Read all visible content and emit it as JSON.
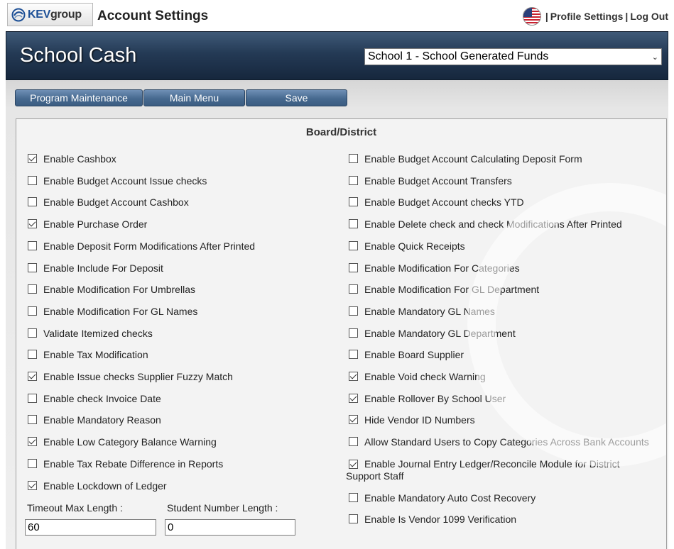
{
  "header": {
    "logo_kev": "KEV",
    "logo_group": "group",
    "app_title": "Account Settings",
    "sep1": "|",
    "profile_settings": "Profile Settings",
    "sep2": "|",
    "log_out": "Log Out"
  },
  "banner": {
    "title": "School Cash",
    "school_selected": "School 1 - School Generated Funds"
  },
  "toolbar": {
    "program_maintenance": "Program Maintenance",
    "main_menu": "Main Menu",
    "save": "Save"
  },
  "panel": {
    "title": "Board/District",
    "left_options": [
      {
        "label": "Enable Cashbox",
        "checked": true
      },
      {
        "label": "Enable Budget Account Issue checks",
        "checked": false
      },
      {
        "label": "Enable Budget Account Cashbox",
        "checked": false
      },
      {
        "label": "Enable Purchase Order",
        "checked": true
      },
      {
        "label": "Enable Deposit Form Modifications After Printed",
        "checked": false
      },
      {
        "label": "Enable Include For Deposit",
        "checked": false
      },
      {
        "label": "Enable Modification For Umbrellas",
        "checked": false
      },
      {
        "label": "Enable Modification For GL Names",
        "checked": false
      },
      {
        "label": "Validate Itemized checks",
        "checked": false
      },
      {
        "label": "Enable Tax Modification",
        "checked": false
      },
      {
        "label": "Enable Issue checks Supplier Fuzzy Match",
        "checked": true
      },
      {
        "label": "Enable check Invoice Date",
        "checked": false
      },
      {
        "label": "Enable Mandatory Reason",
        "checked": false
      },
      {
        "label": "Enable Low Category Balance Warning",
        "checked": true
      },
      {
        "label": "Enable Tax Rebate Difference in Reports",
        "checked": false
      },
      {
        "label": "Enable Lockdown of Ledger",
        "checked": true
      }
    ],
    "right_options": [
      {
        "label": "Enable Budget Account Calculating Deposit Form",
        "checked": false
      },
      {
        "label": "Enable Budget Account Transfers",
        "checked": false
      },
      {
        "label": "Enable Budget Account checks YTD",
        "checked": false
      },
      {
        "label": "Enable Delete check and check Modifications After Printed",
        "checked": false
      },
      {
        "label": "Enable Quick Receipts",
        "checked": false
      },
      {
        "label": "Enable Modification For Categories",
        "checked": false
      },
      {
        "label": "Enable Modification For GL Department",
        "checked": false
      },
      {
        "label": "Enable Mandatory GL Names",
        "checked": false
      },
      {
        "label": "Enable Mandatory GL Department",
        "checked": false
      },
      {
        "label": "Enable Board Supplier",
        "checked": false
      },
      {
        "label": "Enable Void check Warning",
        "checked": true
      },
      {
        "label": "Enable Rollover By School User",
        "checked": true
      },
      {
        "label": "Hide Vendor ID Numbers",
        "checked": true
      },
      {
        "label": "Allow Standard Users to Copy Categories Across Bank Accounts",
        "checked": false
      },
      {
        "label": "Enable Journal Entry Ledger/Reconcile Module for District Support Staff",
        "checked": true
      },
      {
        "label": "Enable Mandatory Auto Cost Recovery",
        "checked": false
      },
      {
        "label": "Enable Is Vendor 1099 Verification",
        "checked": false
      }
    ],
    "timeout_label": "Timeout Max Length :",
    "timeout_value": "60",
    "student_number_label": "Student Number Length :",
    "student_number_value": "0"
  }
}
